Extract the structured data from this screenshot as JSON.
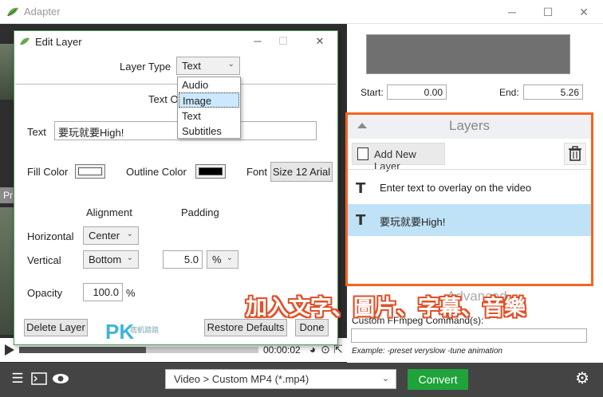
{
  "app": {
    "title": "Adapter"
  },
  "window_controls": {
    "minimize": "─",
    "maximize": "☐",
    "close": "✕"
  },
  "left": {
    "preview_tab": "Pr",
    "timecode": "00:00:02",
    "progress": 0.53
  },
  "trim": {
    "start_label": "Start:",
    "start_value": "0.00",
    "end_label": "End:",
    "end_value": "5.26"
  },
  "layers": {
    "title": "Layers",
    "add_label": "Add New Layer",
    "items": [
      {
        "label": "Enter text to overlay on the video",
        "selected": false
      },
      {
        "label": "要玩就要High!",
        "selected": true
      }
    ]
  },
  "advanced": {
    "title": "Advanced",
    "ffmpeg_label": "Custom FFmpeg Command(s):",
    "ffmpeg_value": "",
    "example": "Example: -preset veryslow -tune animation"
  },
  "bottom": {
    "format": "Video > Custom MP4 (*.mp4)",
    "convert": "Convert"
  },
  "dialog": {
    "title": "Edit Layer",
    "controls": {
      "minimize": "─",
      "maximize": "☐",
      "close": "✕"
    },
    "layer_type_label": "Layer Type",
    "layer_type_value": "Text",
    "layer_type_options": [
      "Audio",
      "Image",
      "Text",
      "Subtitles"
    ],
    "layer_type_hover": "Image",
    "text_options_heading": "Text O",
    "text_label": "Text",
    "text_value": "要玩就要High!",
    "fill_color_label": "Fill Color",
    "fill_color": "#ffffff",
    "outline_color_label": "Outline Color",
    "outline_color": "#000000",
    "font_label": "Font",
    "font_value": "Size 12 Arial",
    "alignment_label": "Alignment",
    "padding_label": "Padding",
    "horizontal_label": "Horizontal",
    "horizontal_value": "Center",
    "vertical_label": "Vertical",
    "vertical_value": "Bottom",
    "padding_value": "5.0",
    "padding_unit": "%",
    "opacity_label": "Opacity",
    "opacity_value": "100.0",
    "opacity_unit": "%",
    "delete_label": "Delete Layer",
    "restore_label": "Restore Defaults",
    "done_label": "Done"
  },
  "watermark": {
    "logo": "PK",
    "sub": "痞凱踏踏"
  },
  "caption": "加入文字、圖片、字幕、音樂",
  "colors": {
    "accent_orange": "#f26522",
    "convert_green": "#1fa33a",
    "selected_row": "#bfe2f7"
  }
}
